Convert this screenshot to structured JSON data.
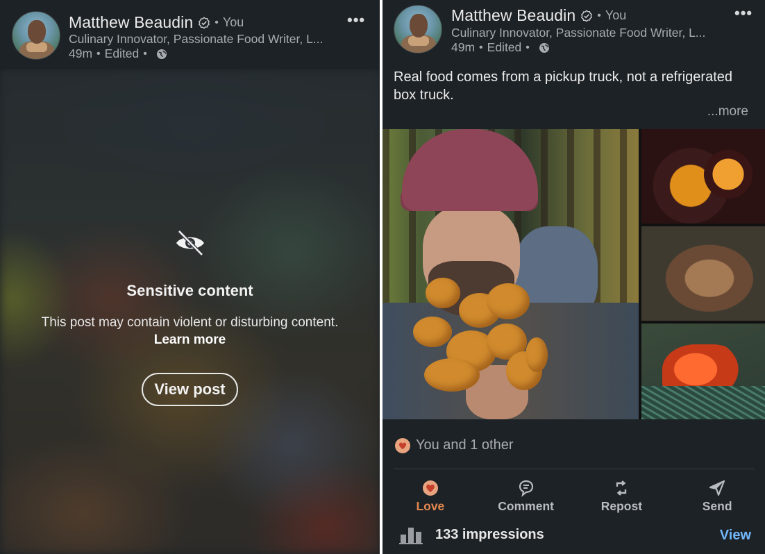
{
  "author": {
    "name": "Matthew Beaudin",
    "you_label": "You",
    "headline": "Culinary Innovator, Passionate Food Writer, L...",
    "time": "49m",
    "edited": "Edited",
    "separator": "•"
  },
  "left_post": {
    "sensitive_title": "Sensitive content",
    "sensitive_text": "This post may contain violent or disturbing content.",
    "learn_more": "Learn more",
    "view_post": "View post",
    "icon": "eye-off-icon"
  },
  "right_post": {
    "text": "Real food comes from a pickup truck, not a refrigerated box truck.",
    "see_more": "...more",
    "reactions_text": "You and 1 other",
    "actions": [
      {
        "label": "Love",
        "icon": "heart-icon"
      },
      {
        "label": "Comment",
        "icon": "comment-icon"
      },
      {
        "label": "Repost",
        "icon": "repost-icon"
      },
      {
        "label": "Send",
        "icon": "send-icon"
      }
    ],
    "impressions": "133 impressions",
    "view_label": "View"
  },
  "colors": {
    "background": "#1d2226",
    "love_accent": "#e2874f",
    "link_blue": "#71b7fb"
  }
}
